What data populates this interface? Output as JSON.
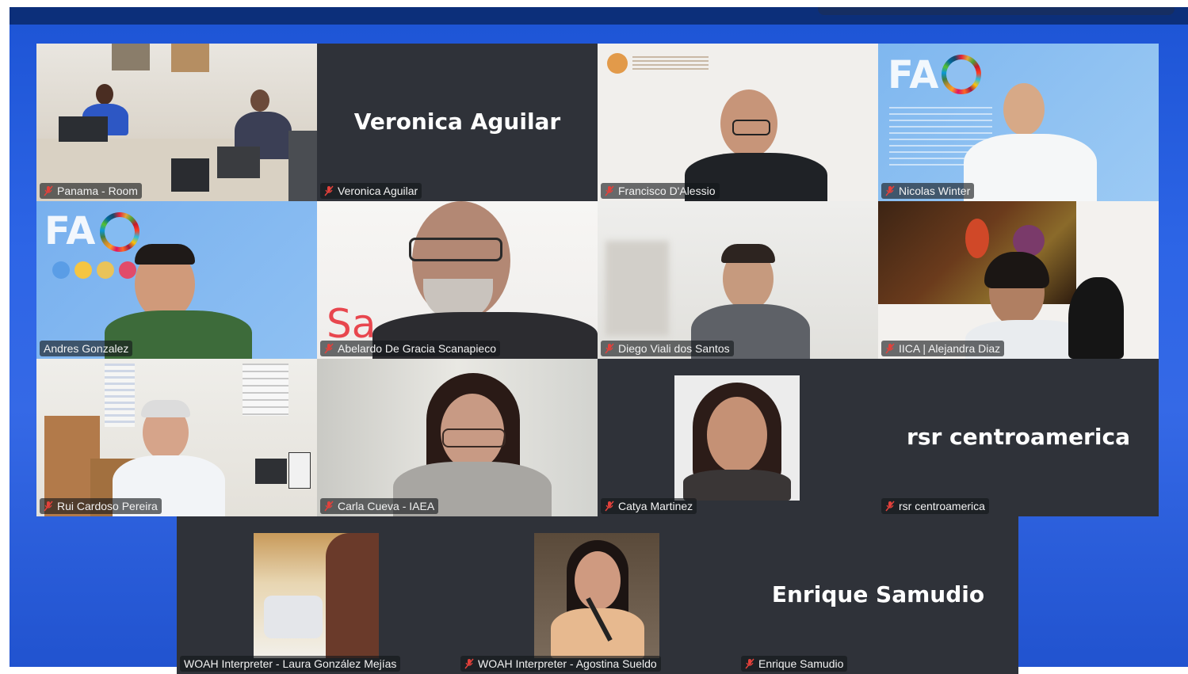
{
  "meeting": {
    "tiles": [
      {
        "label": "Panama - Room"
      },
      {
        "label": "Veronica Aguilar",
        "display_name": "Veronica Aguilar"
      },
      {
        "label": "Francisco D'Alessio"
      },
      {
        "label": "Nicolas Winter"
      },
      {
        "label": "Andres Gonzalez",
        "active_speaker": true
      },
      {
        "label": "Abelardo De Gracia Scanapieco"
      },
      {
        "label": "Diego Viali dos Santos"
      },
      {
        "label": "IICA | Alejandra Diaz"
      },
      {
        "label": "Rui Cardoso Pereira"
      },
      {
        "label": "Carla Cueva - IAEA"
      },
      {
        "label": "Catya Martinez"
      },
      {
        "label": "rsr centroamerica",
        "display_name": "rsr centroamerica"
      },
      {
        "label": "WOAH Interpreter - Laura González Mejías"
      },
      {
        "label": "WOAH Interpreter - Agostina Sueldo"
      },
      {
        "label": "Enrique Samudio",
        "display_name": "Enrique Samudio"
      }
    ],
    "fao_logo_text": "FA",
    "background_text": "Sa"
  },
  "colors": {
    "stage": "#2d65e6",
    "tile_dark": "#2f3239",
    "active_border": "#55e6ee",
    "topbar": "#0c2f7a"
  },
  "icons": {
    "mic": "microphone-muted-icon"
  }
}
